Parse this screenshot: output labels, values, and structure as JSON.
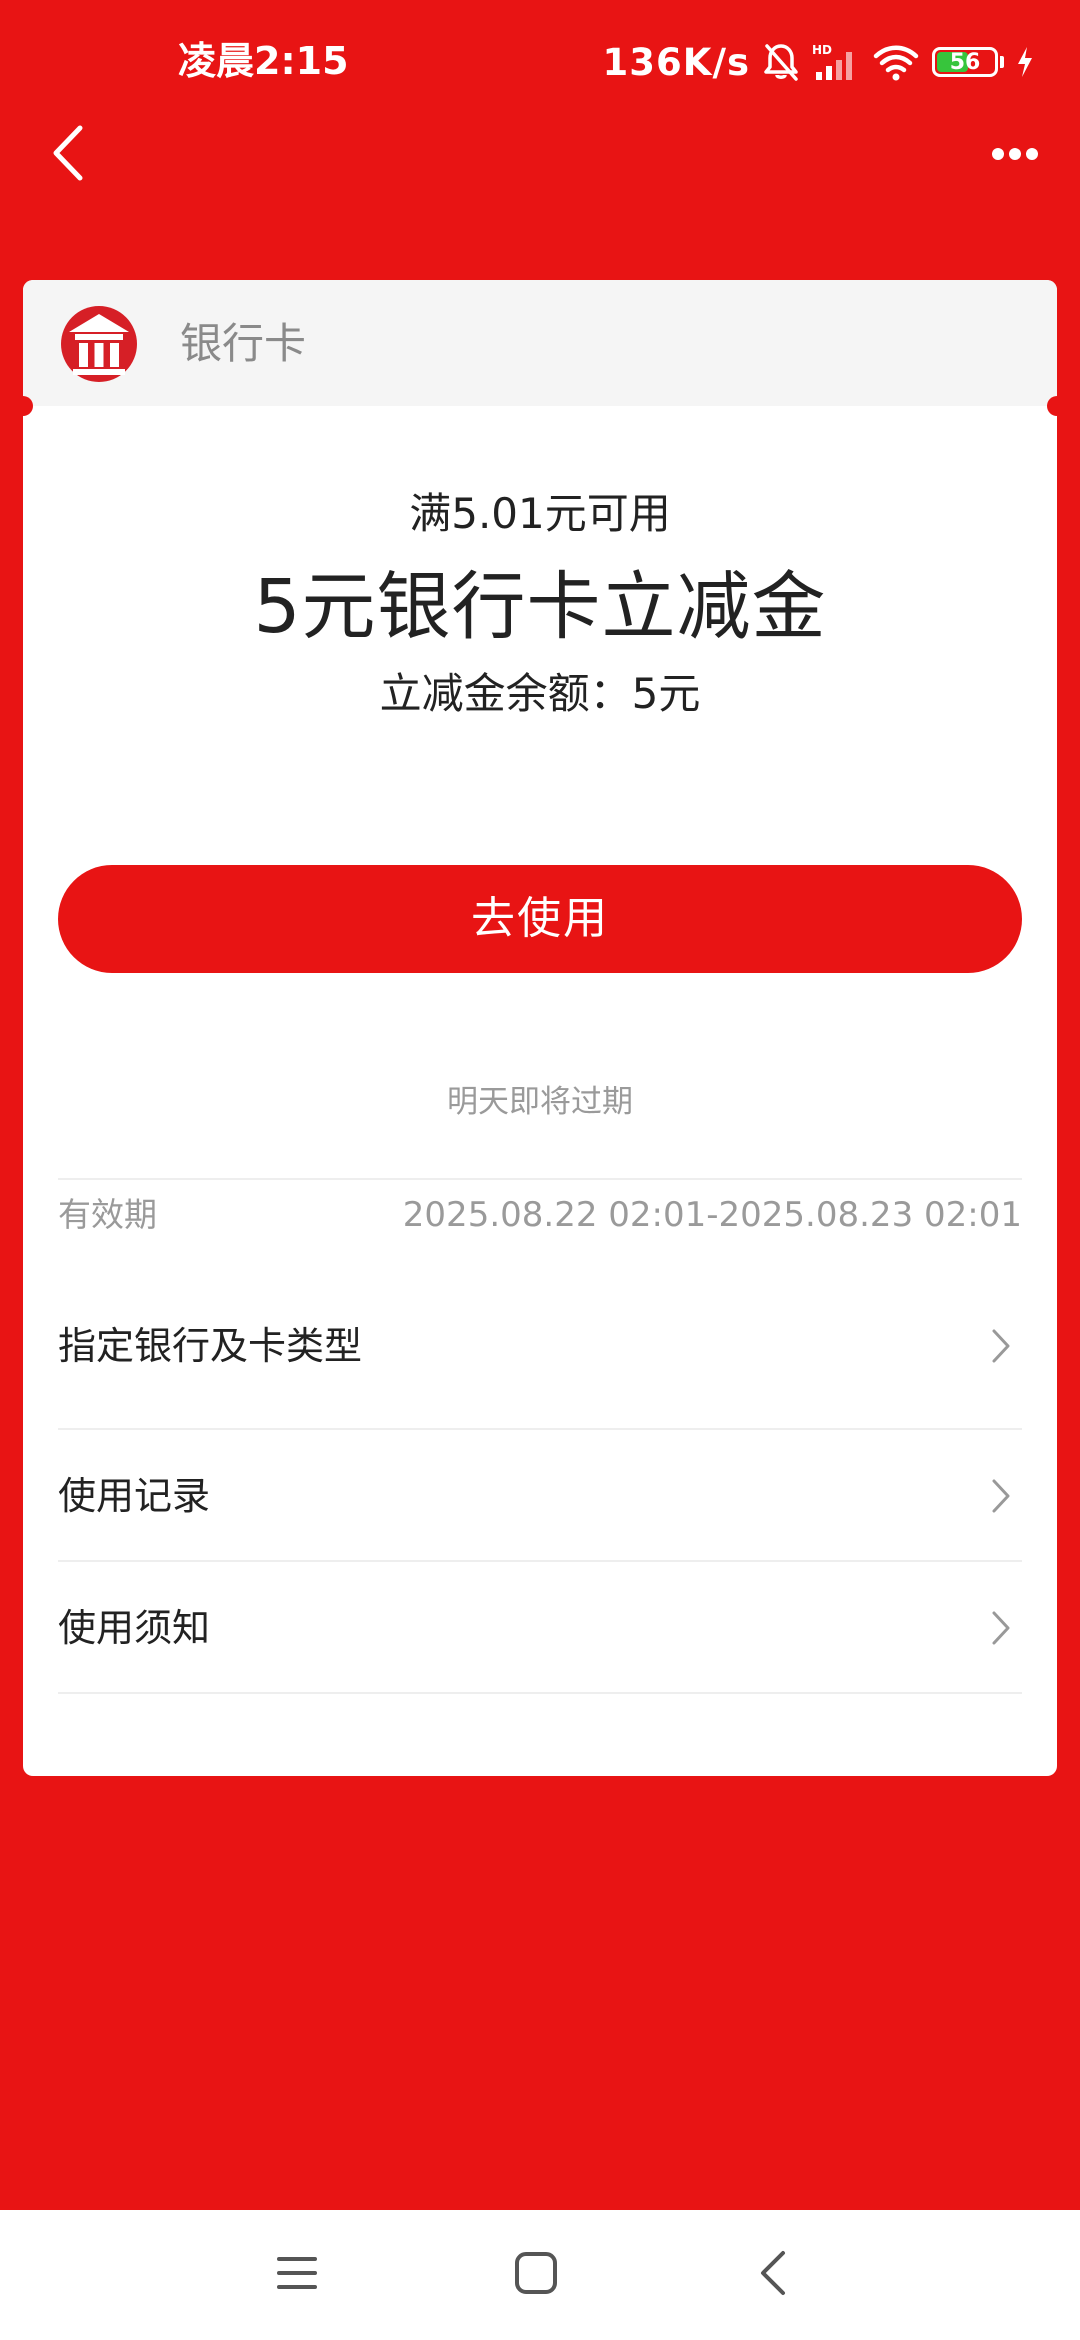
{
  "status_bar": {
    "time": "凌晨2:15",
    "net_speed": "136K/s",
    "battery": "56",
    "battery_level": 0.56
  },
  "colors": {
    "brand_red": "#E81414",
    "card_bg": "#FFFFFF",
    "header_bg": "#F5F5F5",
    "muted_text": "#9A9A9A",
    "battery_green": "#37C53C"
  },
  "nav": {
    "back_icon": "chevron-left-icon",
    "more_icon": "more-horizontal-icon"
  },
  "card": {
    "bank_icon": "bank-icon",
    "bank_name": "银行卡",
    "threshold": "满5.01元可用",
    "title": "5元银行卡立减金",
    "balance": "立减金余额：5元",
    "use_button": "去使用",
    "expire_note": "明天即将过期",
    "validity_label": "有效期",
    "validity_value": "2025.08.22 02:01-2025.08.23 02:01",
    "rows": [
      {
        "label": "指定银行及卡类型"
      },
      {
        "label": "使用记录"
      },
      {
        "label": "使用须知"
      }
    ]
  },
  "system_nav": {
    "menu_icon": "menu-icon",
    "home_icon": "home-square-icon",
    "back_icon": "back-triangle-icon"
  }
}
